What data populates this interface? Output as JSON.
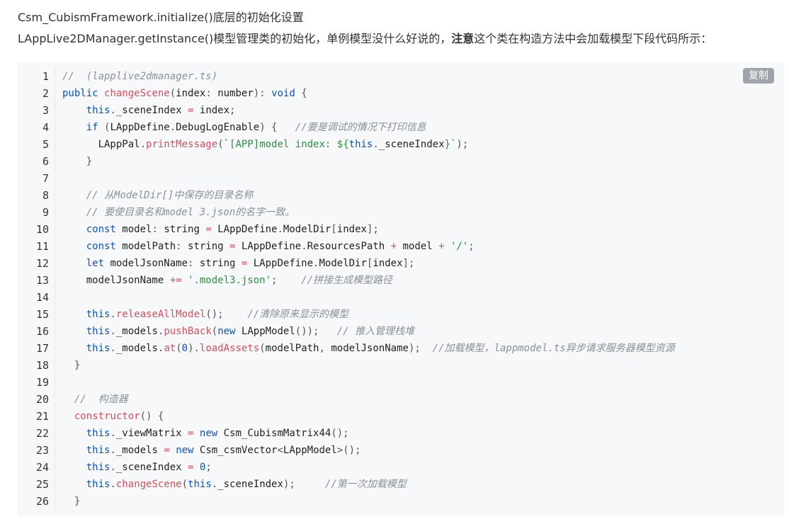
{
  "paragraphs": {
    "p1": "Csm_CubismFramework.initialize()底层的初始化设置",
    "p2_before": "LAppLive2DManager.getInstance()模型管理类的初始化，单例模型没什么好说的，",
    "p2_bold": "注意",
    "p2_after": "这个类在构造方法中会加载模型下段代码所示："
  },
  "code_block": {
    "copy_label": "复制",
    "lines": [
      [
        [
          "com",
          "//  (lapplive2dmanager.ts)"
        ]
      ],
      [
        [
          "kw",
          "public "
        ],
        [
          "fn",
          "changeScene"
        ],
        [
          "punc",
          "("
        ],
        [
          "id",
          "index"
        ],
        [
          "punc",
          ": "
        ],
        [
          "type",
          "number"
        ],
        [
          "punc",
          "): "
        ],
        [
          "kw",
          "void"
        ],
        [
          "punc",
          " {"
        ]
      ],
      [
        [
          "id",
          "    "
        ],
        [
          "kw",
          "this"
        ],
        [
          "punc",
          "."
        ],
        [
          "prop",
          "_sceneIndex"
        ],
        [
          "op",
          " = "
        ],
        [
          "id",
          "index"
        ],
        [
          "punc",
          ";"
        ]
      ],
      [
        [
          "id",
          "    "
        ],
        [
          "kw",
          "if"
        ],
        [
          "punc",
          " ("
        ],
        [
          "cls",
          "LAppDefine"
        ],
        [
          "punc",
          "."
        ],
        [
          "prop",
          "DebugLogEnable"
        ],
        [
          "punc",
          ") {   "
        ],
        [
          "com",
          "//要是调试的情况下打印信息"
        ]
      ],
      [
        [
          "id",
          "      "
        ],
        [
          "cls",
          "LAppPal"
        ],
        [
          "punc",
          "."
        ],
        [
          "fn",
          "printMessage"
        ],
        [
          "punc",
          "("
        ],
        [
          "tpl",
          "`[APP]model index: ${"
        ],
        [
          "kw",
          "this"
        ],
        [
          "punc",
          "."
        ],
        [
          "prop",
          "_sceneIndex"
        ],
        [
          "tpl",
          "}`"
        ],
        [
          "punc",
          ");"
        ]
      ],
      [
        [
          "punc",
          "    }"
        ]
      ],
      [
        [
          "id",
          ""
        ]
      ],
      [
        [
          "id",
          "    "
        ],
        [
          "com",
          "// 从ModelDir[]中保存的目录名称"
        ]
      ],
      [
        [
          "id",
          "    "
        ],
        [
          "com",
          "// 要使目录名和model 3.json的名字一致。"
        ]
      ],
      [
        [
          "id",
          "    "
        ],
        [
          "kw",
          "const "
        ],
        [
          "id",
          "model"
        ],
        [
          "punc",
          ": "
        ],
        [
          "type",
          "string"
        ],
        [
          "op",
          " = "
        ],
        [
          "cls",
          "LAppDefine"
        ],
        [
          "punc",
          "."
        ],
        [
          "prop",
          "ModelDir"
        ],
        [
          "punc",
          "["
        ],
        [
          "id",
          "index"
        ],
        [
          "punc",
          "];"
        ]
      ],
      [
        [
          "id",
          "    "
        ],
        [
          "kw",
          "const "
        ],
        [
          "id",
          "modelPath"
        ],
        [
          "punc",
          ": "
        ],
        [
          "type",
          "string"
        ],
        [
          "op",
          " = "
        ],
        [
          "cls",
          "LAppDefine"
        ],
        [
          "punc",
          "."
        ],
        [
          "prop",
          "ResourcesPath"
        ],
        [
          "op",
          " + "
        ],
        [
          "id",
          "model"
        ],
        [
          "op",
          " + "
        ],
        [
          "str",
          "'/'"
        ],
        [
          "punc",
          ";"
        ]
      ],
      [
        [
          "id",
          "    "
        ],
        [
          "kw",
          "let "
        ],
        [
          "id",
          "modelJsonName"
        ],
        [
          "punc",
          ": "
        ],
        [
          "type",
          "string"
        ],
        [
          "op",
          " = "
        ],
        [
          "cls",
          "LAppDefine"
        ],
        [
          "punc",
          "."
        ],
        [
          "prop",
          "ModelDir"
        ],
        [
          "punc",
          "["
        ],
        [
          "id",
          "index"
        ],
        [
          "punc",
          "];"
        ]
      ],
      [
        [
          "id",
          "    "
        ],
        [
          "id",
          "modelJsonName"
        ],
        [
          "op",
          " += "
        ],
        [
          "str",
          "'.model3.json'"
        ],
        [
          "punc",
          ";    "
        ],
        [
          "com",
          "//拼接生成模型路径"
        ]
      ],
      [
        [
          "id",
          ""
        ]
      ],
      [
        [
          "id",
          "    "
        ],
        [
          "kw",
          "this"
        ],
        [
          "punc",
          "."
        ],
        [
          "fn",
          "releaseAllModel"
        ],
        [
          "punc",
          "();    "
        ],
        [
          "com",
          "//清除原来显示的模型"
        ]
      ],
      [
        [
          "id",
          "    "
        ],
        [
          "kw",
          "this"
        ],
        [
          "punc",
          "."
        ],
        [
          "prop",
          "_models"
        ],
        [
          "punc",
          "."
        ],
        [
          "fn",
          "pushBack"
        ],
        [
          "punc",
          "("
        ],
        [
          "kw",
          "new "
        ],
        [
          "cls",
          "LAppModel"
        ],
        [
          "punc",
          "());   "
        ],
        [
          "com",
          "// 推入管理栈堆"
        ]
      ],
      [
        [
          "id",
          "    "
        ],
        [
          "kw",
          "this"
        ],
        [
          "punc",
          "."
        ],
        [
          "prop",
          "_models"
        ],
        [
          "punc",
          "."
        ],
        [
          "fn",
          "at"
        ],
        [
          "punc",
          "("
        ],
        [
          "num",
          "0"
        ],
        [
          "punc",
          ")."
        ],
        [
          "fn",
          "loadAssets"
        ],
        [
          "punc",
          "("
        ],
        [
          "id",
          "modelPath"
        ],
        [
          "punc",
          ", "
        ],
        [
          "id",
          "modelJsonName"
        ],
        [
          "punc",
          ");  "
        ],
        [
          "com",
          "//加载模型，lappmodel.ts异步请求服务器模型资源"
        ]
      ],
      [
        [
          "punc",
          "  }"
        ]
      ],
      [
        [
          "id",
          ""
        ]
      ],
      [
        [
          "id",
          "  "
        ],
        [
          "com",
          "//  构造器"
        ]
      ],
      [
        [
          "id",
          "  "
        ],
        [
          "fn",
          "constructor"
        ],
        [
          "punc",
          "() {"
        ]
      ],
      [
        [
          "id",
          "    "
        ],
        [
          "kw",
          "this"
        ],
        [
          "punc",
          "."
        ],
        [
          "prop",
          "_viewMatrix"
        ],
        [
          "op",
          " = "
        ],
        [
          "kw",
          "new "
        ],
        [
          "cls",
          "Csm_CubismMatrix44"
        ],
        [
          "punc",
          "();"
        ]
      ],
      [
        [
          "id",
          "    "
        ],
        [
          "kw",
          "this"
        ],
        [
          "punc",
          "."
        ],
        [
          "prop",
          "_models"
        ],
        [
          "op",
          " = "
        ],
        [
          "kw",
          "new "
        ],
        [
          "cls",
          "Csm_csmVector"
        ],
        [
          "punc",
          "<"
        ],
        [
          "cls",
          "LAppModel"
        ],
        [
          "punc",
          ">();"
        ]
      ],
      [
        [
          "id",
          "    "
        ],
        [
          "kw",
          "this"
        ],
        [
          "punc",
          "."
        ],
        [
          "prop",
          "_sceneIndex"
        ],
        [
          "op",
          " = "
        ],
        [
          "num",
          "0"
        ],
        [
          "punc",
          ";"
        ]
      ],
      [
        [
          "id",
          "    "
        ],
        [
          "kw",
          "this"
        ],
        [
          "punc",
          "."
        ],
        [
          "fn",
          "changeScene"
        ],
        [
          "punc",
          "("
        ],
        [
          "kw",
          "this"
        ],
        [
          "punc",
          "."
        ],
        [
          "prop",
          "_sceneIndex"
        ],
        [
          "punc",
          ");     "
        ],
        [
          "com",
          "//第一次加载模型"
        ]
      ],
      [
        [
          "punc",
          "  }"
        ]
      ]
    ],
    "line_numbers": [
      "1",
      "2",
      "3",
      "4",
      "5",
      "6",
      "7",
      "8",
      "9",
      "10",
      "11",
      "12",
      "13",
      "14",
      "15",
      "16",
      "17",
      "18",
      "19",
      "20",
      "21",
      "22",
      "23",
      "24",
      "25",
      "26"
    ]
  },
  "colors": {
    "keyword": "#0e54b4",
    "function": "#d84e5e",
    "string": "#2a8f3f",
    "comment": "#8a8f98",
    "background": "#f6f8fa"
  }
}
